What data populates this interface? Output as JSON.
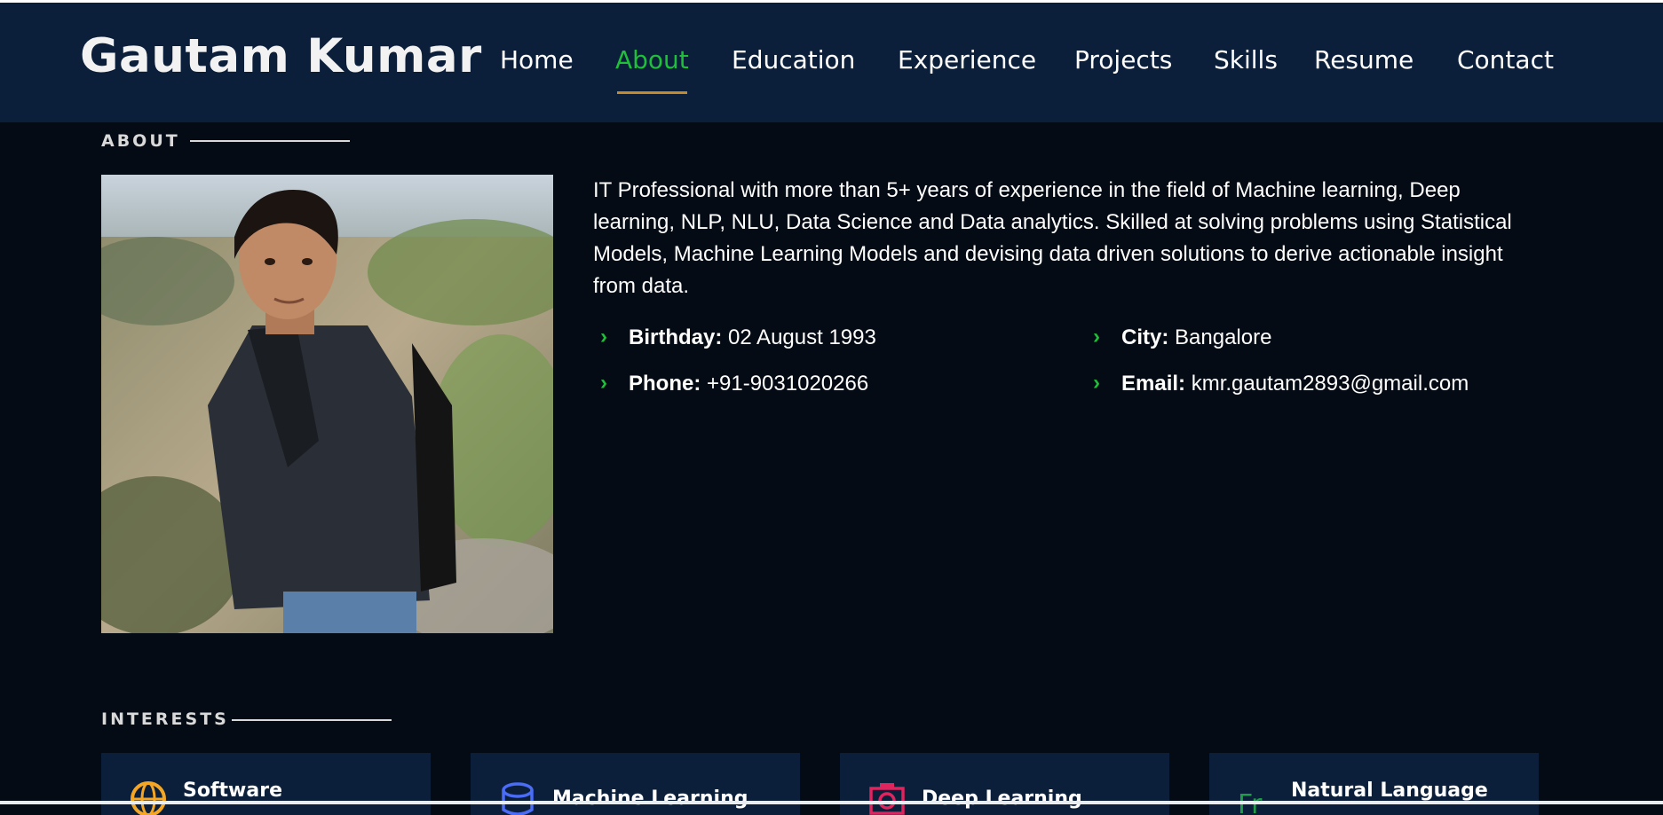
{
  "header": {
    "brand": "Gautam Kumar",
    "nav": [
      {
        "label": "Home"
      },
      {
        "label": "About"
      },
      {
        "label": "Education"
      },
      {
        "label": "Experience"
      },
      {
        "label": "Projects"
      },
      {
        "label": "Skills"
      },
      {
        "label": "Resume"
      },
      {
        "label": "Contact"
      }
    ],
    "active_nav": "About"
  },
  "about": {
    "section_title": "ABOUT",
    "summary": "IT Professional with more than 5+ years of experience in the field of Machine learning, Deep learning, NLP, NLU, Data Science and Data analytics. Skilled at solving problems using Statistical Models, Machine Learning Models and devising data driven solutions to derive actionable insight from data.",
    "details": {
      "birthday": {
        "label": "Birthday:",
        "value": "02 August 1993"
      },
      "city": {
        "label": "City:",
        "value": "Bangalore"
      },
      "phone": {
        "label": "Phone:",
        "value": "+91-9031020266"
      },
      "email": {
        "label": "Email:",
        "value": "kmr.gautam2893@gmail.com"
      }
    }
  },
  "interests": {
    "section_title": "INTERESTS",
    "items": [
      {
        "label": "Software",
        "icon": "globe-icon",
        "color": "#f5a623"
      },
      {
        "label": "Machine Learning",
        "icon": "database-icon",
        "color": "#4a6cf7"
      },
      {
        "label": "Deep Learning",
        "icon": "camera-icon",
        "color": "#e0245e"
      },
      {
        "label": "Natural Language",
        "icon": "language-icon",
        "color": "#1f9e46"
      }
    ]
  },
  "colors": {
    "header_bg": "#0b1f3b",
    "page_bg": "#040b14",
    "accent_green": "#1fbf3a",
    "nav_underline": "#c48a2a"
  }
}
